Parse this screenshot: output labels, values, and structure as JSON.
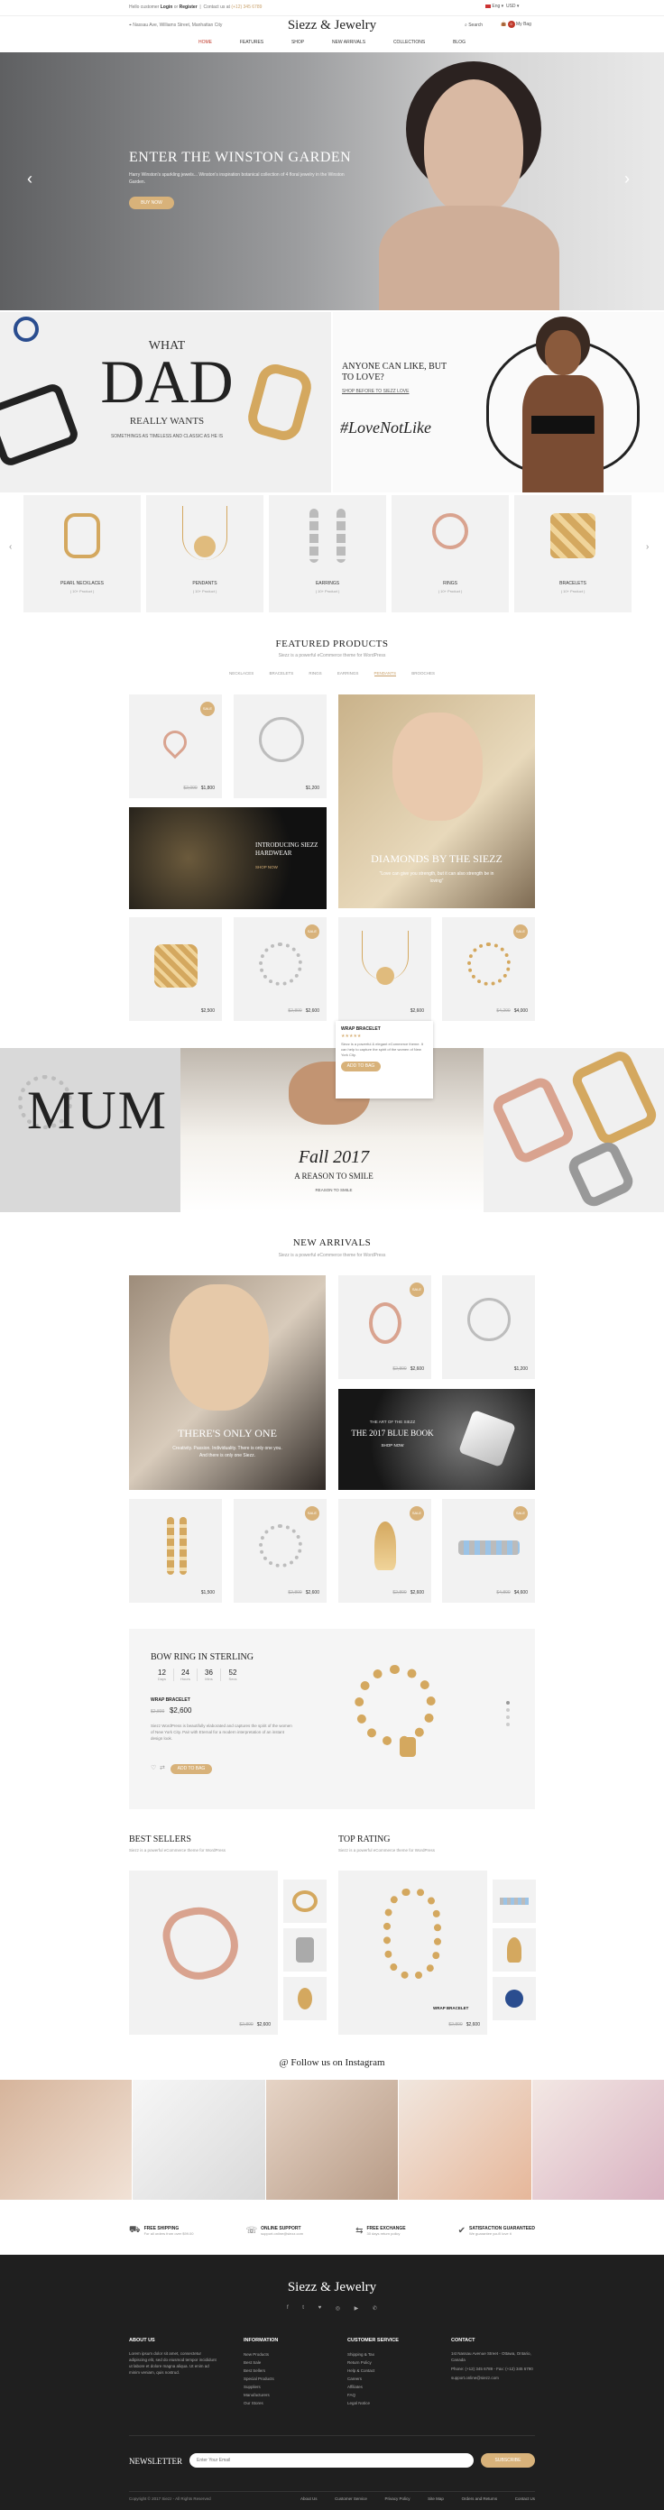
{
  "topbar": {
    "greeting": "Hello customer",
    "login": "Login",
    "or": "or",
    "register": "Register",
    "contact": "Contact us at",
    "phone": "(+12) 345 6789",
    "address": "Nassau Ave, Williams Street, Manhattan City",
    "lang": "Eng",
    "currency": "USD",
    "search_label": "Search",
    "cart_label": "My Bag",
    "cart_count": "0"
  },
  "brand": {
    "logo": "Siezz & Jewelry"
  },
  "nav": [
    "HOME",
    "FEATURES",
    "SHOP",
    "NEW ARRIVALS",
    "COLLECTIONS",
    "BLOG"
  ],
  "hero": {
    "title": "ENTER THE WINSTON GARDEN",
    "text": "Harry Winston's sparkling jewels... Winston's inspiration botanical collection of 4 floral jewelry in the Winston Garden.",
    "cta": "BUY NOW"
  },
  "promo_dad": {
    "what": "WHAT",
    "dad": "DAD",
    "really": "REALLY WANTS",
    "text": "SOMETHINGS AS TIMELESS AND CLASSIC AS HE IS"
  },
  "promo_love": {
    "title": "ANYONE CAN LIKE, BUT TO LOVE?",
    "link": "SHOP BEFORE TO SIEZZ LOVE",
    "tag": "#LoveNotLike"
  },
  "categories": [
    {
      "name": "PEARL NECKLACES",
      "count": "( 10+ Product )"
    },
    {
      "name": "PENDANTS",
      "count": "( 10+ Product )"
    },
    {
      "name": "EARRINGS",
      "count": "( 10+ Product )"
    },
    {
      "name": "RINGS",
      "count": "( 10+ Product )"
    },
    {
      "name": "BRACELETS",
      "count": "( 10+ Product )"
    }
  ],
  "featured": {
    "title": "FEATURED PRODUCTS",
    "subtitle": "Siezz is a powerful eCommerce theme for WordPress",
    "tabs": [
      "NECKLACES",
      "BRACELETS",
      "RINGS",
      "EARRINGS",
      "PENDANTS",
      "BROOCHES"
    ],
    "active_tab": "PENDANTS",
    "p1_old": "$2,000",
    "p1_new": "$1,800",
    "p2_new": "$1,200",
    "banner_dark_title": "INTRODUCING SIEZZ HARDWEAR",
    "banner_dark_cta": "SHOP NOW",
    "diamond_title": "DIAMONDS BY THE SIEZZ",
    "diamond_text": "\"Love can give you strength, but it can also strength be in loving\"",
    "row_prices": [
      {
        "old": "",
        "new": "$2,500"
      },
      {
        "old": "$2,800",
        "new": "$2,600"
      },
      {
        "old": "",
        "new": "$2,600"
      },
      {
        "old": "$4,200",
        "new": "$4,000"
      }
    ],
    "popup_name": "WRAP BRACELET",
    "popup_stars": "★★★★★",
    "popup_text": "Siezz is a powerful & elegant eCommerce theme. It can help to capture the spirit of the women of New York City.",
    "popup_cta": "ADD TO BAG"
  },
  "mum_slider": {
    "mum": "MUM",
    "fall": "Fall 2017",
    "reason": "A REASON TO SMILE",
    "cta": "REASON TO SMILE"
  },
  "new_arrivals": {
    "title": "NEW ARRIVALS",
    "subtitle": "Siezz is a powerful eCommerce theme for WordPress",
    "only_one_title": "THERE'S ONLY ONE",
    "only_one_text": "Creativity. Passion. Individuality. There is only one you. And there is only one Siezz.",
    "p1_old": "$2,800",
    "p1_new": "$2,600",
    "p2_new": "$1,200",
    "blue_book_kicker": "THE ART OF THE SIEZZ",
    "blue_book_title": "THE 2017 BLUE BOOK",
    "blue_book_cta": "SHOP NOW",
    "row_prices": [
      {
        "old": "",
        "new": "$1,500"
      },
      {
        "old": "$2,800",
        "new": "$2,600"
      },
      {
        "old": "$2,800",
        "new": "$2,600"
      },
      {
        "old": "$4,800",
        "new": "$4,600"
      }
    ]
  },
  "deal": {
    "title": "BOW RING IN STERLING",
    "countdown": [
      {
        "num": "12",
        "label": "Days"
      },
      {
        "num": "24",
        "label": "Hours"
      },
      {
        "num": "36",
        "label": "Mins"
      },
      {
        "num": "52",
        "label": "Secs"
      }
    ],
    "product": "WRAP BRACELET",
    "old_price": "$2,800",
    "new_price": "$2,600",
    "text": "Siezz WordPress is beautifully elaborated and captures the spirit of the women of New York City. Pair with Eternal for a modern interpretation of an instant design look.",
    "cta": "ADD TO BAG"
  },
  "best_sellers": {
    "title": "BEST SELLERS",
    "subtitle": "Siezz is a powerful eCommerce theme for WordPress",
    "old": "$2,800",
    "new": "$2,600"
  },
  "top_rating": {
    "title": "TOP RATING",
    "subtitle": "Siezz is a powerful eCommerce theme for WordPress",
    "product": "WRAP BRACELET",
    "old": "$2,800",
    "new": "$2,600"
  },
  "instagram": {
    "title": "@ Follow us on Instagram"
  },
  "services": [
    {
      "title": "FREE SHIPPING",
      "text": "For all orders from over $99.00"
    },
    {
      "title": "ONLINE SUPPORT",
      "text": "support.online@siezz.com"
    },
    {
      "title": "FREE EXCHANGE",
      "text": "30 days return policy"
    },
    {
      "title": "SATISFACTION GUARANTEED",
      "text": "We guarantee you'll love it"
    }
  ],
  "footer": {
    "logo": "Siezz & Jewelry",
    "social": [
      "f",
      "t",
      "♥",
      "◎",
      "▶",
      "✆"
    ],
    "about_title": "ABOUT US",
    "about_text": "Lorem ipsum dolor sit amet, consectetur adipiscing elit, sed do eiusmod tempor incididunt ut labore et dolore magna aliqua. Ut enim ad minim veniam, quis nostrud.",
    "info_title": "INFORMATION",
    "info_links": [
      "New Products",
      "Best Sale",
      "Best Sellers",
      "Special Products",
      "Suppliers",
      "Manufacturers",
      "Our Stores"
    ],
    "cs_title": "CUSTOMER SERVICE",
    "cs_links": [
      "Shipping & Tax",
      "Return Policy",
      "Help & Contact",
      "Careers",
      "Affiliates",
      "FAQ",
      "Legal Notice"
    ],
    "contact_title": "CONTACT",
    "contact_lines": [
      "1st Nassau Avenue Street - Ottawa, Ontario, Canada",
      "Phone: (+12) 345 6789 - Fax: (+12) 345 6790",
      "support.online@siezz.com"
    ],
    "newsletter_label": "NEWSLETTER",
    "newsletter_placeholder": "Enter Your Email",
    "subscribe": "SUBSCRIBE",
    "copyright": "Copyright © 2017 Siezz - All Rights Reserved",
    "bottom_links": [
      "About Us",
      "Customer Service",
      "Privacy Policy",
      "Site Map",
      "Orders and Returns",
      "Contact Us"
    ]
  }
}
